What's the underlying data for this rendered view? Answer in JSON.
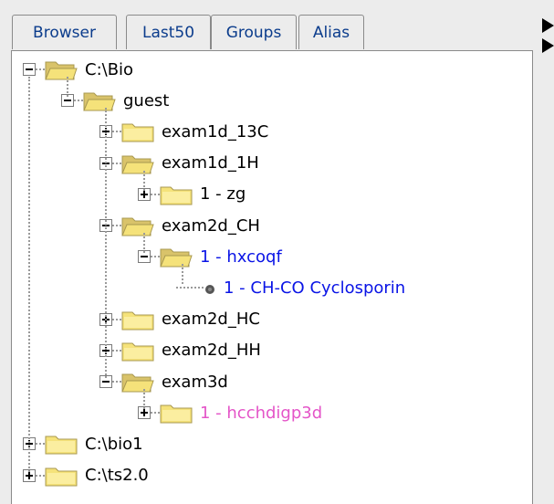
{
  "tabs": [
    {
      "label": "Browser",
      "active": true
    },
    {
      "label": "Last50",
      "active": false
    },
    {
      "label": "Groups",
      "active": false
    },
    {
      "label": "Alias",
      "active": false
    }
  ],
  "tree": [
    {
      "label": "C:\\Bio",
      "depth": 0,
      "toggle": "minus",
      "icon": "folder-open-icon",
      "color": "#000000"
    },
    {
      "label": "guest",
      "depth": 1,
      "toggle": "minus",
      "icon": "folder-open-icon",
      "color": "#000000"
    },
    {
      "label": "exam1d_13C",
      "depth": 2,
      "toggle": "plus",
      "icon": "folder-closed-icon",
      "color": "#000000"
    },
    {
      "label": "exam1d_1H",
      "depth": 2,
      "toggle": "minus",
      "icon": "folder-open-icon",
      "color": "#000000"
    },
    {
      "label": "1 - zg",
      "depth": 3,
      "toggle": "plus",
      "icon": "folder-closed-icon",
      "color": "#000000"
    },
    {
      "label": "exam2d_CH",
      "depth": 2,
      "toggle": "minus",
      "icon": "folder-open-icon",
      "color": "#000000"
    },
    {
      "label": "1 - hxcoqf",
      "depth": 3,
      "toggle": "minus",
      "icon": "folder-open-icon",
      "color": "#0a14e6"
    },
    {
      "label": "1 - CH-CO Cyclosporin",
      "depth": 4,
      "toggle": "none",
      "icon": "bullet-icon",
      "color": "#0a14e6"
    },
    {
      "label": "exam2d_HC",
      "depth": 2,
      "toggle": "plus",
      "icon": "folder-closed-icon",
      "color": "#000000"
    },
    {
      "label": "exam2d_HH",
      "depth": 2,
      "toggle": "plus",
      "icon": "folder-closed-icon",
      "color": "#000000"
    },
    {
      "label": "exam3d",
      "depth": 2,
      "toggle": "minus",
      "icon": "folder-open-icon",
      "color": "#000000"
    },
    {
      "label": "1 - hcchdigp3d",
      "depth": 3,
      "toggle": "plus",
      "icon": "folder-closed-icon",
      "color": "#e455c8"
    },
    {
      "label": "C:\\bio1",
      "depth": 0,
      "toggle": "plus",
      "icon": "folder-closed-icon",
      "color": "#000000"
    },
    {
      "label": "C:\\ts2.0",
      "depth": 0,
      "toggle": "plus",
      "icon": "folder-closed-icon",
      "color": "#000000"
    }
  ],
  "colors": {
    "tab_accent": "#f0a030",
    "tab_text": "#0b3c8c",
    "folder": "#f5e27a"
  }
}
